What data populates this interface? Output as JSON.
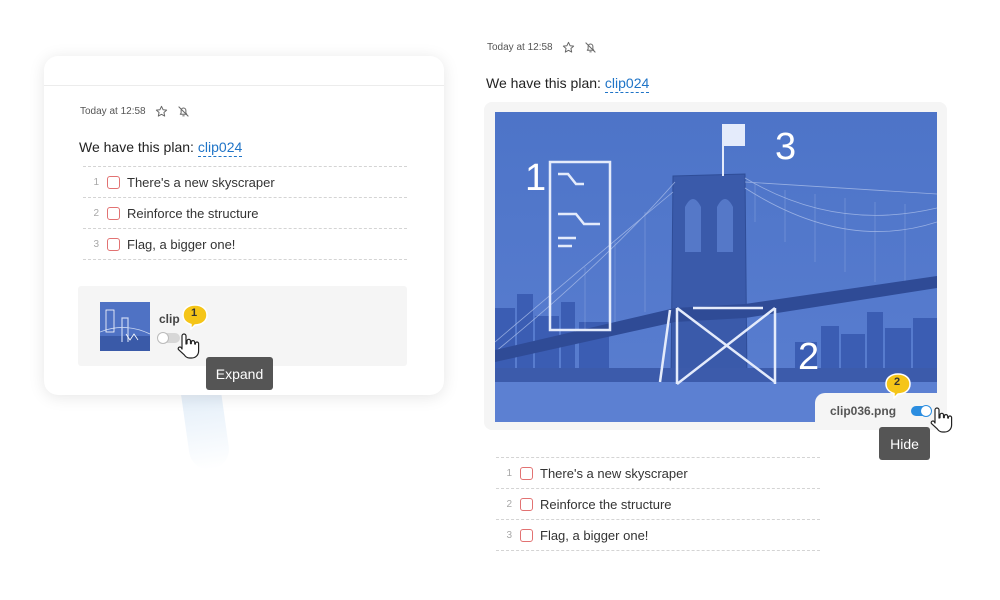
{
  "left_card": {
    "timestamp": "Today at 12:58",
    "plan_text": "We have this plan:",
    "plan_link": "clip024",
    "tasks": [
      {
        "num": "1",
        "label": "There's a new skyscraper"
      },
      {
        "num": "2",
        "label": "Reinforce the structure"
      },
      {
        "num": "3",
        "label": "Flag, a bigger one!"
      }
    ],
    "attachment_name": "clip",
    "tooltip": "Expand",
    "badge": "1"
  },
  "right_panel": {
    "timestamp": "Today at 12:58",
    "plan_text": "We have this plan:",
    "plan_link": "clip024",
    "overlay_labels": {
      "one": "1",
      "two": "2",
      "three": "3"
    },
    "attachment_name": "clip036.png",
    "tooltip": "Hide",
    "badge": "2",
    "tasks": [
      {
        "num": "1",
        "label": "There's a new skyscraper"
      },
      {
        "num": "2",
        "label": "Reinforce the structure"
      },
      {
        "num": "3",
        "label": "Flag, a bigger one!"
      }
    ]
  },
  "icons": [
    "star-icon",
    "bell-off-icon",
    "hand-cursor-icon"
  ],
  "colors": {
    "link": "#1f74c7",
    "checkbox_border": "#e27272",
    "toggle_on": "#2b8de0",
    "tooltip_bg": "#555555",
    "badge": "#f5c518",
    "photo_tint": "#3e62c0"
  }
}
